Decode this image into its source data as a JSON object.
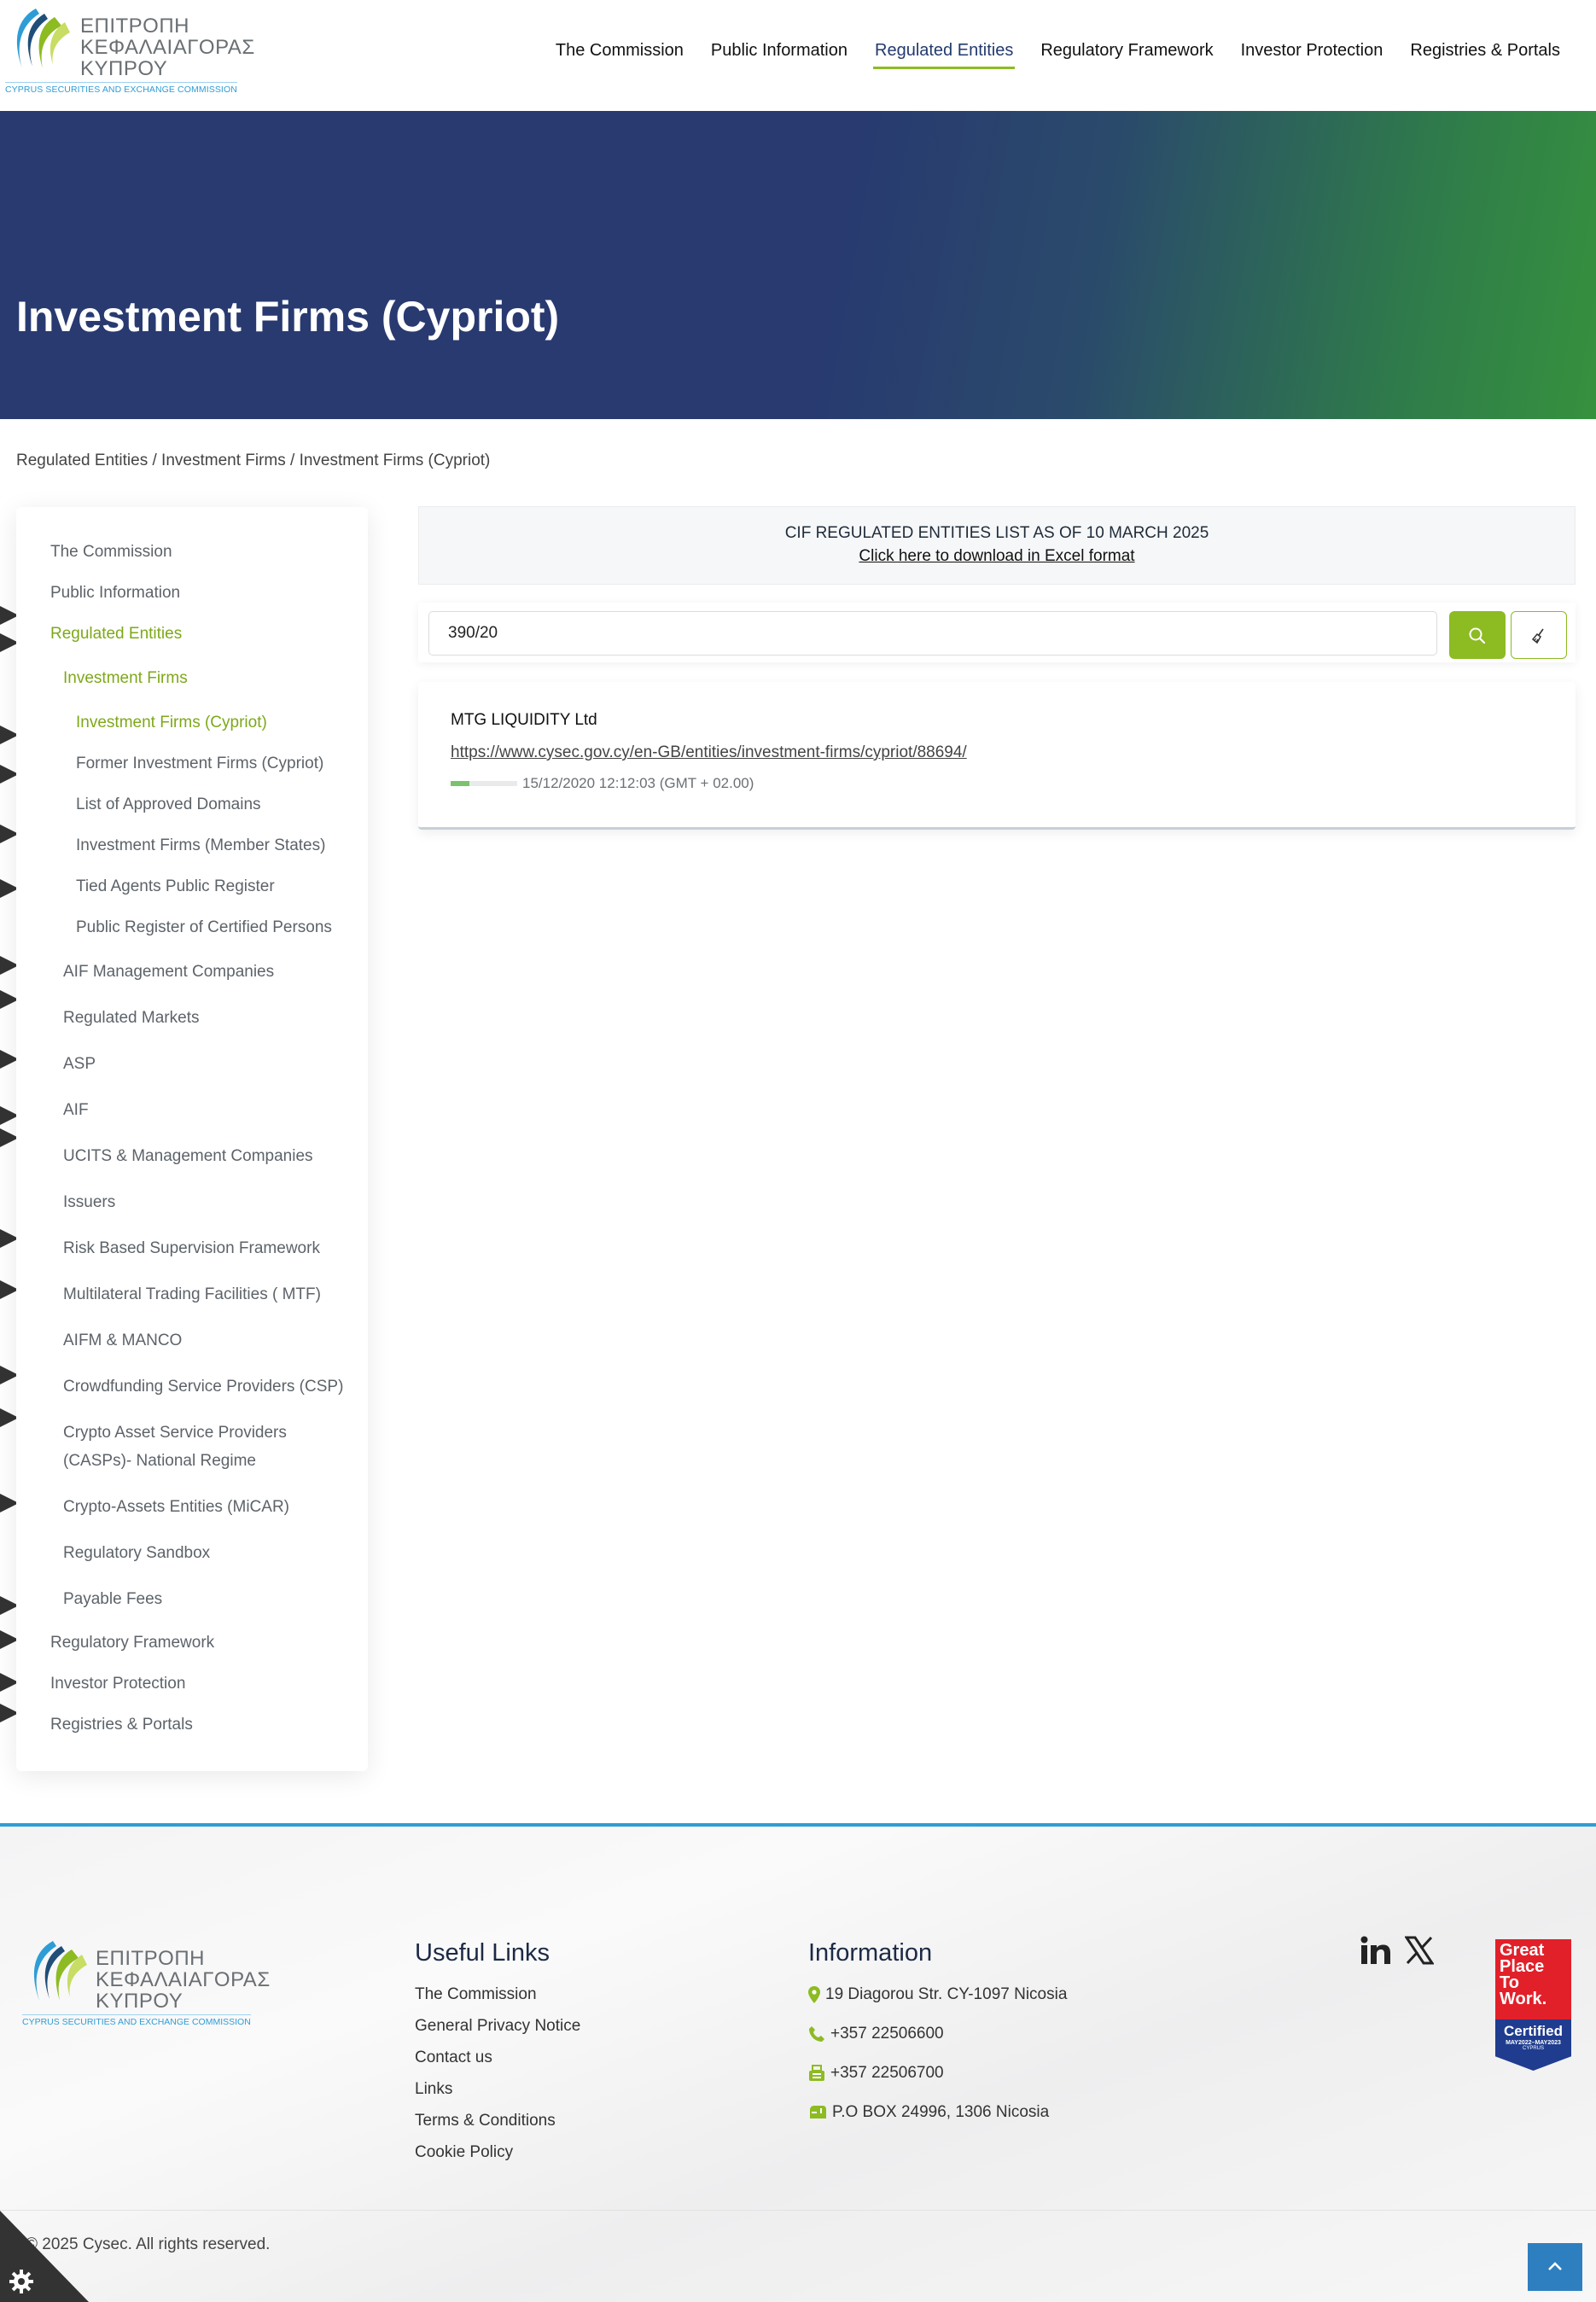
{
  "header": {
    "logo": {
      "greek_lines": [
        "ΕΠΙΤΡΟΠΗ",
        "ΚΕΦΑΛΑΙΑΓΟΡΑΣ",
        "ΚΥΠΡΟΥ"
      ],
      "english": "CYPRUS SECURITIES AND EXCHANGE COMMISSION"
    },
    "nav": [
      {
        "label": "The Commission"
      },
      {
        "label": "Public Information"
      },
      {
        "label": "Regulated Entities",
        "active": true
      },
      {
        "label": "Regulatory Framework"
      },
      {
        "label": "Investor Protection"
      },
      {
        "label": "Registries & Portals"
      }
    ]
  },
  "hero": {
    "title": "Investment Firms (Cypriot)"
  },
  "breadcrumb": "Regulated Entities / Investment Firms / Investment Firms (Cypriot)",
  "sidebar": {
    "items": [
      {
        "label": "The Commission"
      },
      {
        "label": "Public Information"
      },
      {
        "label": "Regulated Entities"
      },
      {
        "label": "Investment Firms"
      },
      {
        "label": "Investment Firms (Cypriot)"
      },
      {
        "label": "Former Investment Firms (Cypriot)"
      },
      {
        "label": "List of Approved Domains"
      },
      {
        "label": "Investment Firms (Member States)"
      },
      {
        "label": "Tied Agents Public Register"
      },
      {
        "label": "Public Register of Certified Persons"
      },
      {
        "label": "AIF Management Companies"
      },
      {
        "label": "Regulated Markets"
      },
      {
        "label": "ASP"
      },
      {
        "label": "AIF"
      },
      {
        "label": "UCITS & Management Companies"
      },
      {
        "label": "Issuers"
      },
      {
        "label": "Risk Based Supervision Framework"
      },
      {
        "label": "Multilateral Trading Facilities ( MTF)"
      },
      {
        "label": "AIFM & MANCO"
      },
      {
        "label": "Crowdfunding Service Providers (CSP)"
      },
      {
        "label": "Crypto Asset Service Providers"
      },
      {
        "label": "(CASPs)- National Regime"
      },
      {
        "label": "Crypto-Assets Entities (MiCAR)"
      },
      {
        "label": "Regulatory Sandbox"
      },
      {
        "label": "Payable Fees"
      },
      {
        "label": "Regulatory Framework"
      },
      {
        "label": "Investor Protection"
      },
      {
        "label": "Registries & Portals"
      }
    ]
  },
  "notice": {
    "title": "CIF REGULATED ENTITIES LIST AS OF 10 MARCH 2025",
    "download_link": "Click here to download in Excel format"
  },
  "search": {
    "value": "390/20"
  },
  "result": {
    "name": "MTG LIQUIDITY Ltd",
    "url": "https://www.cysec.gov.cy/en-GB/entities/investment-firms/cypriot/88694/",
    "progress_fraction": 0.28,
    "date": "15/12/2020 12:12:03 (GMT + 02.00)"
  },
  "footer": {
    "logo": {
      "greek_lines": [
        "ΕΠΙΤΡΟΠΗ",
        "ΚΕΦΑΛΑΙΑΓΟΡΑΣ",
        "ΚΥΠΡΟΥ"
      ],
      "english": "CYPRUS SECURITIES AND EXCHANGE COMMISSION"
    },
    "useful_links": {
      "title": "Useful Links",
      "links": [
        "The Commission",
        "General Privacy Notice",
        "Contact us",
        "Links",
        "Terms & Conditions",
        "Cookie Policy"
      ]
    },
    "information": {
      "title": "Information",
      "address": "19 Diagorou Str. CY-1097 Nicosia",
      "phone": "+357 22506600",
      "fax": "+357 22506700",
      "po_box": "P.O BOX 24996, 1306 Nicosia"
    },
    "social": [
      "linkedin-icon",
      "x-icon"
    ],
    "badge": {
      "lines": [
        "Great",
        "Place",
        "To",
        "Work."
      ],
      "certified": "Certified",
      "dates": "MAY2022–MAY2023",
      "country": "CYPRUS"
    },
    "copyright": "© 2025 Cysec. All rights reserved."
  },
  "colors": {
    "brand_green": "#8dbb22",
    "navy": "#283a70",
    "footer_accent": "#2e9dd6"
  }
}
